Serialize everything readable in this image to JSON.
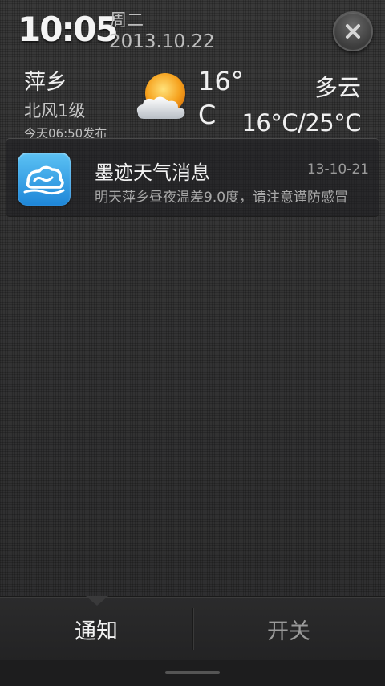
{
  "header": {
    "time": "10:05",
    "weekday": "周二",
    "date": "2013.10.22",
    "close_icon": "close-icon"
  },
  "weather": {
    "city": "萍乡",
    "wind": "北风1级",
    "publish_time": "今天06:50发布",
    "current_temp": "16°C",
    "condition": "多云",
    "temp_range": "16°C/25°C",
    "icon": "partly-cloudy-icon"
  },
  "notification": {
    "app_icon": "moji-weather-icon",
    "title": "墨迹天气消息",
    "time": "13-10-21",
    "body": "明天萍乡昼夜温差9.0度，请注意谨防感冒"
  },
  "tabs": [
    {
      "label": "通知",
      "selected": true
    },
    {
      "label": "开关",
      "selected": false
    }
  ],
  "colors": {
    "background": "#333334",
    "text_primary": "#f0f0f0",
    "text_secondary": "#a8a8a8",
    "app_icon_blue": "#2a95e0"
  }
}
